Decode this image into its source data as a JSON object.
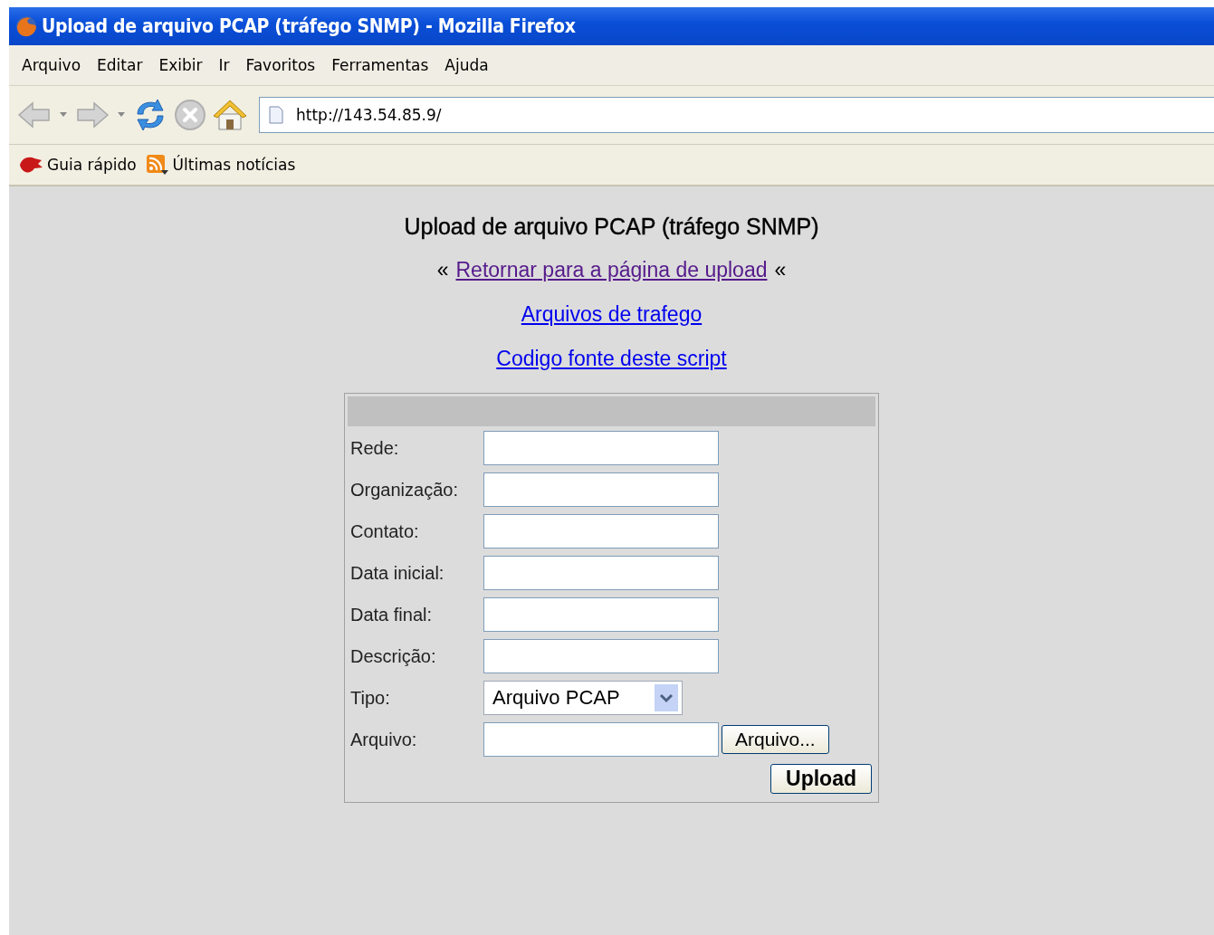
{
  "window": {
    "title": "Upload de arquivo PCAP (tráfego SNMP) - Mozilla Firefox"
  },
  "menu": [
    "Arquivo",
    "Editar",
    "Exibir",
    "Ir",
    "Favoritos",
    "Ferramentas",
    "Ajuda"
  ],
  "address_bar": {
    "value": "http://143.54.85.9/"
  },
  "bookmarks": [
    {
      "label": "Guia rápido",
      "kind": "guide"
    },
    {
      "label": "Últimas notícias",
      "kind": "feed"
    }
  ],
  "page": {
    "heading": "Upload de arquivo PCAP (tráfego SNMP)",
    "links": [
      {
        "prefix": "«",
        "label": "Retornar para a página de upload",
        "suffix": "«",
        "visited": true
      },
      {
        "label": "Arquivos de trafego",
        "visited": false
      },
      {
        "label": "Codigo fonte deste script",
        "visited": false
      }
    ],
    "form": {
      "fields": [
        {
          "label": "Rede:",
          "kind": "text"
        },
        {
          "label": "Organização:",
          "kind": "text"
        },
        {
          "label": "Contato:",
          "kind": "text"
        },
        {
          "label": "Data inicial:",
          "kind": "text"
        },
        {
          "label": "Data final:",
          "kind": "text"
        },
        {
          "label": "Descrição:",
          "kind": "text"
        },
        {
          "label": "Tipo:",
          "kind": "select",
          "value": "Arquivo PCAP"
        },
        {
          "label": "Arquivo:",
          "kind": "file",
          "button": "Arquivo..."
        }
      ],
      "submit": "Upload"
    }
  }
}
